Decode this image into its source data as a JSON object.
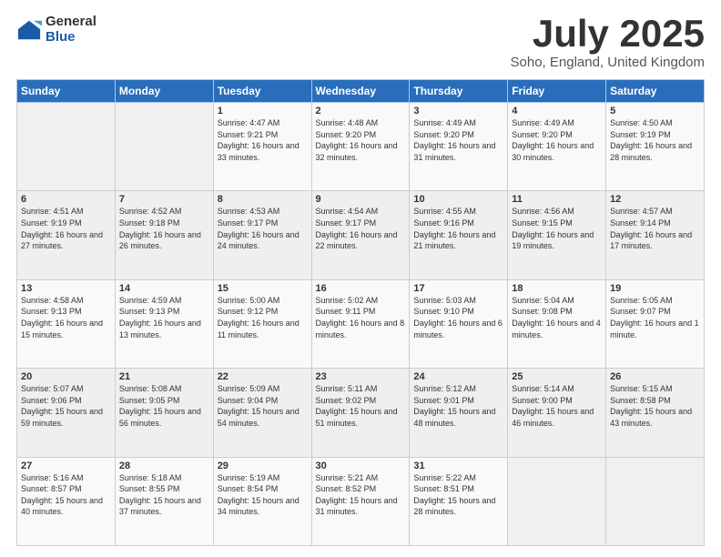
{
  "logo": {
    "general": "General",
    "blue": "Blue"
  },
  "title": "July 2025",
  "subtitle": "Soho, England, United Kingdom",
  "days_header": [
    "Sunday",
    "Monday",
    "Tuesday",
    "Wednesday",
    "Thursday",
    "Friday",
    "Saturday"
  ],
  "weeks": [
    [
      {
        "day": "",
        "info": ""
      },
      {
        "day": "",
        "info": ""
      },
      {
        "day": "1",
        "info": "Sunrise: 4:47 AM\nSunset: 9:21 PM\nDaylight: 16 hours and 33 minutes."
      },
      {
        "day": "2",
        "info": "Sunrise: 4:48 AM\nSunset: 9:20 PM\nDaylight: 16 hours and 32 minutes."
      },
      {
        "day": "3",
        "info": "Sunrise: 4:49 AM\nSunset: 9:20 PM\nDaylight: 16 hours and 31 minutes."
      },
      {
        "day": "4",
        "info": "Sunrise: 4:49 AM\nSunset: 9:20 PM\nDaylight: 16 hours and 30 minutes."
      },
      {
        "day": "5",
        "info": "Sunrise: 4:50 AM\nSunset: 9:19 PM\nDaylight: 16 hours and 28 minutes."
      }
    ],
    [
      {
        "day": "6",
        "info": "Sunrise: 4:51 AM\nSunset: 9:19 PM\nDaylight: 16 hours and 27 minutes."
      },
      {
        "day": "7",
        "info": "Sunrise: 4:52 AM\nSunset: 9:18 PM\nDaylight: 16 hours and 26 minutes."
      },
      {
        "day": "8",
        "info": "Sunrise: 4:53 AM\nSunset: 9:17 PM\nDaylight: 16 hours and 24 minutes."
      },
      {
        "day": "9",
        "info": "Sunrise: 4:54 AM\nSunset: 9:17 PM\nDaylight: 16 hours and 22 minutes."
      },
      {
        "day": "10",
        "info": "Sunrise: 4:55 AM\nSunset: 9:16 PM\nDaylight: 16 hours and 21 minutes."
      },
      {
        "day": "11",
        "info": "Sunrise: 4:56 AM\nSunset: 9:15 PM\nDaylight: 16 hours and 19 minutes."
      },
      {
        "day": "12",
        "info": "Sunrise: 4:57 AM\nSunset: 9:14 PM\nDaylight: 16 hours and 17 minutes."
      }
    ],
    [
      {
        "day": "13",
        "info": "Sunrise: 4:58 AM\nSunset: 9:13 PM\nDaylight: 16 hours and 15 minutes."
      },
      {
        "day": "14",
        "info": "Sunrise: 4:59 AM\nSunset: 9:13 PM\nDaylight: 16 hours and 13 minutes."
      },
      {
        "day": "15",
        "info": "Sunrise: 5:00 AM\nSunset: 9:12 PM\nDaylight: 16 hours and 11 minutes."
      },
      {
        "day": "16",
        "info": "Sunrise: 5:02 AM\nSunset: 9:11 PM\nDaylight: 16 hours and 8 minutes."
      },
      {
        "day": "17",
        "info": "Sunrise: 5:03 AM\nSunset: 9:10 PM\nDaylight: 16 hours and 6 minutes."
      },
      {
        "day": "18",
        "info": "Sunrise: 5:04 AM\nSunset: 9:08 PM\nDaylight: 16 hours and 4 minutes."
      },
      {
        "day": "19",
        "info": "Sunrise: 5:05 AM\nSunset: 9:07 PM\nDaylight: 16 hours and 1 minute."
      }
    ],
    [
      {
        "day": "20",
        "info": "Sunrise: 5:07 AM\nSunset: 9:06 PM\nDaylight: 15 hours and 59 minutes."
      },
      {
        "day": "21",
        "info": "Sunrise: 5:08 AM\nSunset: 9:05 PM\nDaylight: 15 hours and 56 minutes."
      },
      {
        "day": "22",
        "info": "Sunrise: 5:09 AM\nSunset: 9:04 PM\nDaylight: 15 hours and 54 minutes."
      },
      {
        "day": "23",
        "info": "Sunrise: 5:11 AM\nSunset: 9:02 PM\nDaylight: 15 hours and 51 minutes."
      },
      {
        "day": "24",
        "info": "Sunrise: 5:12 AM\nSunset: 9:01 PM\nDaylight: 15 hours and 48 minutes."
      },
      {
        "day": "25",
        "info": "Sunrise: 5:14 AM\nSunset: 9:00 PM\nDaylight: 15 hours and 46 minutes."
      },
      {
        "day": "26",
        "info": "Sunrise: 5:15 AM\nSunset: 8:58 PM\nDaylight: 15 hours and 43 minutes."
      }
    ],
    [
      {
        "day": "27",
        "info": "Sunrise: 5:16 AM\nSunset: 8:57 PM\nDaylight: 15 hours and 40 minutes."
      },
      {
        "day": "28",
        "info": "Sunrise: 5:18 AM\nSunset: 8:55 PM\nDaylight: 15 hours and 37 minutes."
      },
      {
        "day": "29",
        "info": "Sunrise: 5:19 AM\nSunset: 8:54 PM\nDaylight: 15 hours and 34 minutes."
      },
      {
        "day": "30",
        "info": "Sunrise: 5:21 AM\nSunset: 8:52 PM\nDaylight: 15 hours and 31 minutes."
      },
      {
        "day": "31",
        "info": "Sunrise: 5:22 AM\nSunset: 8:51 PM\nDaylight: 15 hours and 28 minutes."
      },
      {
        "day": "",
        "info": ""
      },
      {
        "day": "",
        "info": ""
      }
    ]
  ]
}
